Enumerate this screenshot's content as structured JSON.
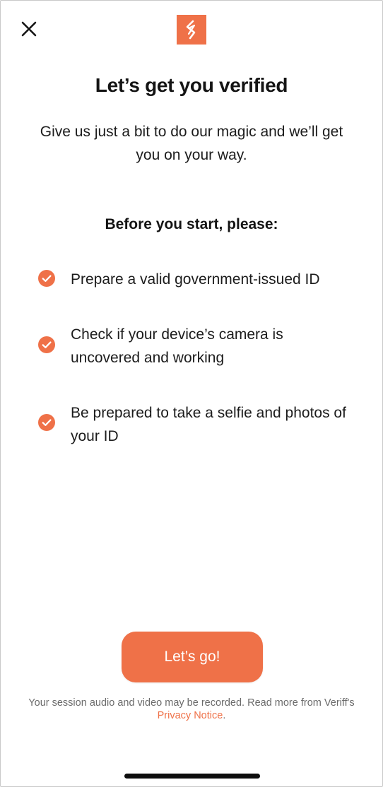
{
  "header": {
    "close_icon": "close-icon",
    "logo_icon": "veriff-logo-icon",
    "brand_color": "#ef7148"
  },
  "intro": {
    "title": "Let’s get you verified",
    "subtitle": "Give us just a bit to do our magic and we’ll get you on your way."
  },
  "checklist": {
    "heading": "Before you start, please:",
    "icon": "check-circle-icon",
    "items": [
      {
        "text": "Prepare a valid government-issued ID"
      },
      {
        "text": "Check if your device’s camera is uncovered and working"
      },
      {
        "text": "Be prepared to take a selfie and photos of your ID"
      }
    ]
  },
  "actions": {
    "primary_label": "Let’s go!"
  },
  "footer": {
    "disclaimer_text": "Your session audio and video may be recorded. Read more from Veriff's ",
    "privacy_link_label": "Privacy Notice",
    "disclaimer_end": "."
  }
}
